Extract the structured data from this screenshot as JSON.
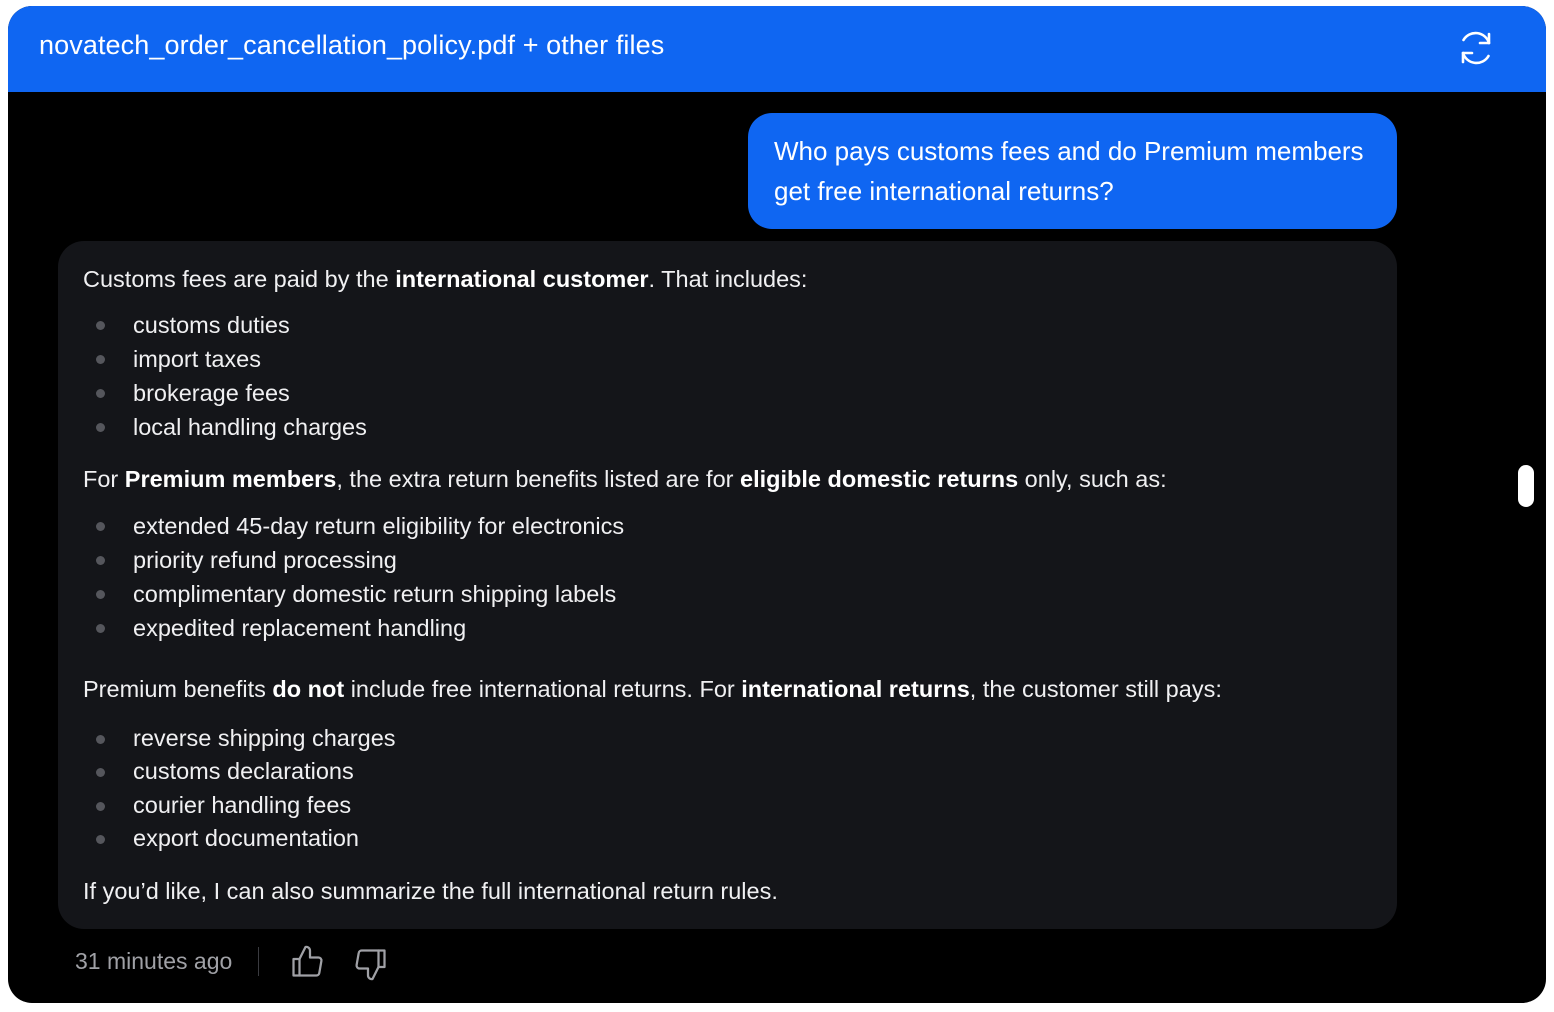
{
  "header": {
    "title": "novatech_order_cancellation_policy.pdf + other files",
    "refresh_icon": "refresh-icon"
  },
  "user_message": {
    "line1": "Who pays customs fees and do Premium members",
    "line2": "get free international returns?"
  },
  "reply": {
    "p1": {
      "before": "Customs fees are paid by the ",
      "bold": "international customer",
      "after": ". That includes:"
    },
    "list1": [
      "customs duties",
      "import taxes",
      "brokerage fees",
      "local handling charges"
    ],
    "p2": {
      "t1": "For ",
      "b1": "Premium members",
      "t2": ", the extra return benefits listed are for ",
      "b2": "eligible domestic returns",
      "t3": " only, such as:"
    },
    "list2": [
      "extended 45-day return eligibility for electronics",
      "priority refund processing",
      "complimentary domestic return shipping labels",
      "expedited replacement handling"
    ],
    "p3": {
      "t1": "Premium benefits ",
      "b1": "do not",
      "t2": " include free international returns. For ",
      "b2": "international returns",
      "t3": ", the customer still pays:"
    },
    "list3": [
      "reverse shipping charges",
      "customs declarations",
      "courier handling fees",
      "export documentation"
    ],
    "p4": "If you’d like, I can also summarize the full international return rules."
  },
  "footer": {
    "timestamp": "31 minutes ago",
    "like_icon": "thumbs-up-icon",
    "dislike_icon": "thumbs-down-icon"
  },
  "colors": {
    "accent": "#0f66f2",
    "background": "#000000",
    "reply_bubble": "#141519"
  }
}
